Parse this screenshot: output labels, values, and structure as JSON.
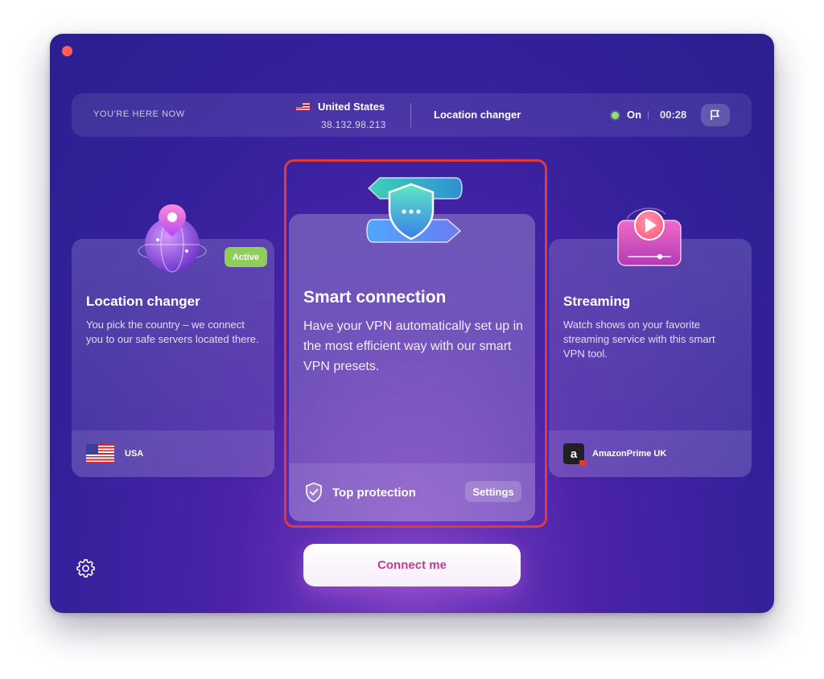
{
  "topbar": {
    "here_label": "YOU'RE HERE NOW",
    "country": "United States",
    "ip": "38.132.98.213",
    "mode": "Location changer",
    "status": "On",
    "timer": "00:28"
  },
  "cards": {
    "location": {
      "title": "Location changer",
      "description": "You pick the country – we connect you to our safe servers located there.",
      "badge": "Active",
      "footer": "USA"
    },
    "smart": {
      "title": "Smart connection",
      "description": "Have your VPN automatically set up in the most efficient way with our smart VPN presets.",
      "footer": "Top protection",
      "settings": "Settings"
    },
    "streaming": {
      "title": "Streaming",
      "description": "Watch shows on your favorite streaming service with this smart VPN tool.",
      "footer": "AmazonPrime UK"
    }
  },
  "actions": {
    "connect": "Connect me"
  },
  "icons": [
    "close-dot",
    "flag-icon",
    "globe-pin-icon",
    "shield-route-icon",
    "play-screen-icon",
    "shield-check-icon",
    "gear-icon",
    "us-flag-icon",
    "amazon-logo"
  ],
  "colors": {
    "active_badge": "#8fce59",
    "status_dot": "#8ee26b",
    "connect_text": "#c0408f",
    "highlight": "#e03a3a"
  }
}
